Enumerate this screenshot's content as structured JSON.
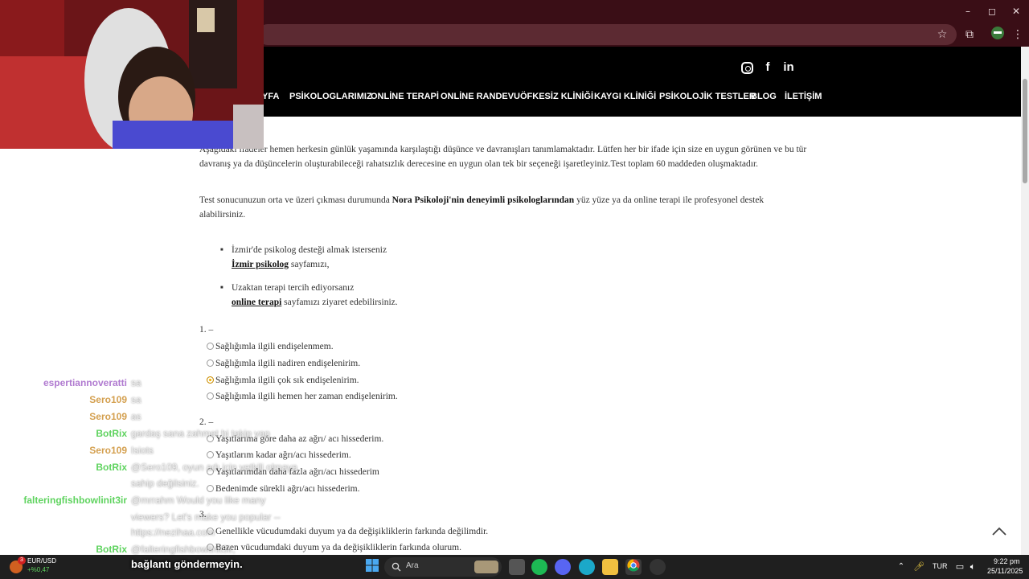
{
  "browser": {
    "window_controls": {
      "minimize": "–",
      "maximize": "◻",
      "close": "✕"
    }
  },
  "site": {
    "nav": [
      "YFA",
      "PSİKOLOGLARIMIZ",
      "ONLİNE TERAPİ",
      "ONLİNE RANDEVU",
      "ÖFKESİZ KLİNİĞİ",
      "KAYGI KLİNİĞİ",
      "PSİKOLOJİK TESTLER",
      "BLOG",
      "İLETİŞİM"
    ],
    "social_icons": [
      "instagram-icon",
      "facebook-icon",
      "linkedin-icon"
    ]
  },
  "content": {
    "intro_line1": "Aşağıdaki ifadeler hemen herkesin günlük yaşamında karşılaştığı düşünce ve davranışları tanımlamaktadır. Lütfen her bir ifade için size en uygun görünen ve bu tür",
    "intro_line2": "davranış ya da düşüncelerin oluşturabileceği rahatsızlık derecesine en uygun olan tek bir seçeneği işaretleyiniz.Test toplam 60 maddeden oluşmaktadır.",
    "result_pre": "Test sonucunuzun orta ve üzeri çıkması durumunda ",
    "result_bold": "Nora Psikoloji'nin deneyimli psikologlarından",
    "result_post": " yüz yüze ya da online terapi ile profesyonel destek",
    "result_line2": "alabilirsiniz.",
    "bullet1_line1": "İzmir'de psikolog desteği almak isterseniz",
    "bullet1_link": "İzmir psikolog",
    "bullet1_post": " sayfamızı,",
    "bullet2_line1": "Uzaktan terapi tercih ediyorsanız",
    "bullet2_link": "online terapi",
    "bullet2_post": " sayfamızı ziyaret edebilirsiniz.",
    "questions": [
      {
        "title": "1.  –",
        "options": [
          "Sağlığımla ilgili endişelenmem.",
          "Sağlığımla ilgili nadiren endişelenirim.",
          "Sağlığımla ilgili çok sık endişelenirim.",
          "Sağlığımla ilgili hemen her zaman endişelenirim."
        ],
        "selected": 2
      },
      {
        "title": "2.  –",
        "options": [
          "Yaşıtlarıma göre daha az ağrı/ acı hissederim.",
          "Yaşıtlarım kadar ağrı/acı hissederim.",
          "Yaşıtlarımdan daha fazla ağrı/acı hissederim",
          "Bedenimde sürekli ağrı/acı hissederim."
        ],
        "selected": -1
      },
      {
        "title": "3.",
        "options": [
          "Genellikle vücudumdaki duyum ya da değişikliklerin farkında değilimdir.",
          "Bazen vücudumdaki duyum ya da değişikliklerin farkında olurum."
        ],
        "selected": -1
      }
    ]
  },
  "chat": [
    {
      "user": "espertiannoveratti",
      "color": "#b07ad0",
      "msg": "sa"
    },
    {
      "user": "Sero109",
      "color": "#d4a050",
      "msg": "sa"
    },
    {
      "user": "Sero109",
      "color": "#d4a050",
      "msg": "as"
    },
    {
      "user": "BotRix",
      "color": "#5fd35f",
      "msg": "gardaş sana zahmet bi takip yap"
    },
    {
      "user": "Sero109",
      "color": "#d4a050",
      "msg": "Isiots"
    },
    {
      "user": "BotRix",
      "color": "#5fd35f",
      "msg": "@Sero109, oyun adı için yetkili olmaya"
    },
    {
      "user": "",
      "color": "#5fd35f",
      "msg": "sahip değilsiniz."
    },
    {
      "user": "falteringfishbowlinit3ir",
      "color": "#5fd35f",
      "msg": "@mrrahm Would you like many"
    },
    {
      "user": "",
      "color": "#5fd35f",
      "msg": "viewers? Let's make you popular --"
    },
    {
      "user": "",
      "color": "#5fd35f",
      "msg": "https://nezihaa.com"
    },
    {
      "user": "BotRix",
      "color": "#5fd35f",
      "msg": "@falteringfishbowlinit3ir,"
    }
  ],
  "banner": "bağlantı göndermeyin.",
  "taskbar": {
    "ticker_label": "EUR/USD",
    "ticker_change": "+%0,47",
    "ticker_badge": "3",
    "search_placeholder": "Ara",
    "lang": "TUR",
    "time": "9:22 pm",
    "date": "25/11/2025"
  }
}
